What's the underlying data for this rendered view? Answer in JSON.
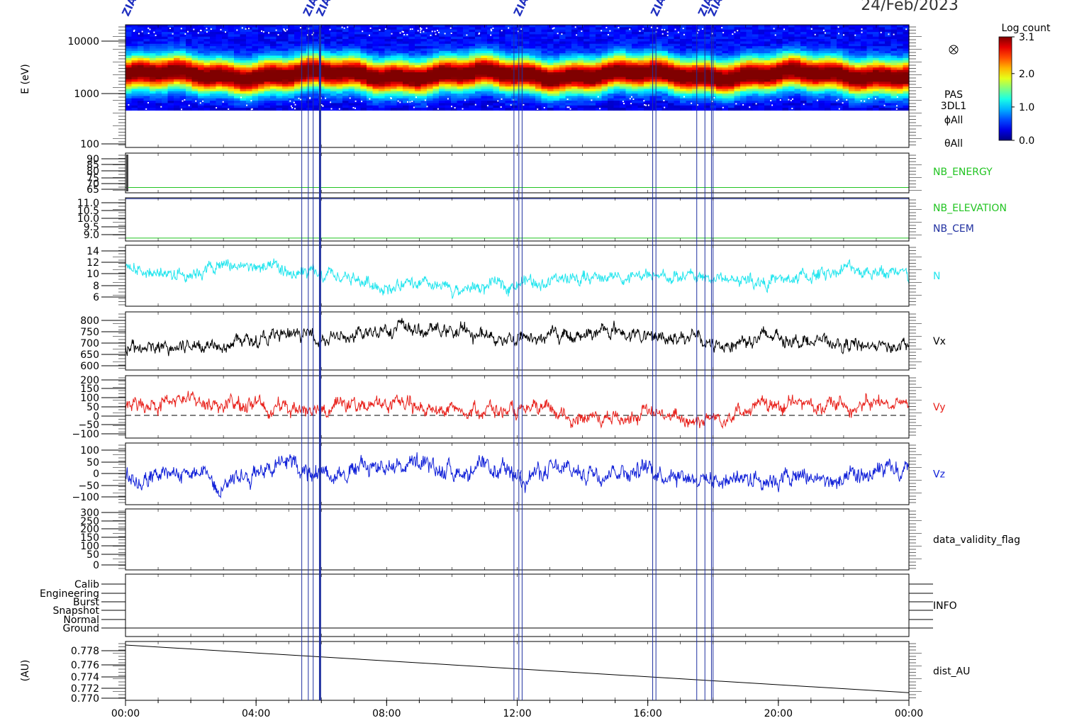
{
  "date_label": "24/Feb/2023",
  "x_tick_labels": [
    "00:00",
    "04:00",
    "08:00",
    "12:00",
    "16:00",
    "20:00",
    "00:00"
  ],
  "event_marker_label": "ZIAS",
  "event_markers_hours": [
    5.4,
    5.6,
    5.75,
    5.95,
    5.97,
    11.9,
    12.05,
    12.15,
    16.15,
    16.25,
    17.5,
    17.75,
    17.95,
    18.0
  ],
  "colorbar": {
    "title": "Log count",
    "ticks": [
      "3.1",
      "2.0",
      "1.0",
      "0.0"
    ],
    "min": 0.0,
    "max": 3.1
  },
  "spectrogram_labels": [
    "PAS",
    "3DL1",
    "ϕAll",
    "θAll"
  ],
  "colors": {
    "cyan": "#22e5ee",
    "black": "#000000",
    "red": "#e8201a",
    "blue": "#1020d8",
    "green": "#22c422",
    "navy": "#2030a0",
    "frame": "#000000"
  },
  "chart_data": [
    {
      "type": "heatmap",
      "name": "energy_spectrogram",
      "ylabel": "E (eV)",
      "yscale": "log",
      "ylim": [
        100,
        20000
      ],
      "y_tick_labels": [
        "10000",
        "1000",
        "100"
      ],
      "x_range_hours": [
        0,
        24
      ],
      "peak_energy_ev": 2300,
      "data_min_energy_ev": 500
    },
    {
      "type": "line",
      "name": "NB_ENERGY",
      "legend": "NB_ENERGY",
      "legend_color": "#22c422",
      "ylim": [
        62,
        92
      ],
      "y_tick_labels": [
        "90",
        "85",
        "80",
        "75",
        "70",
        "65"
      ],
      "constant_value": 66
    },
    {
      "type": "line",
      "series_labels": [
        "NB_ELEVATION",
        "NB_CEM"
      ],
      "legend_colors": [
        "#22c422",
        "#2030a0"
      ],
      "ylim": [
        8.85,
        11.05
      ],
      "y_tick_labels": [
        "11.0",
        "10.5",
        "10.0",
        "9.5",
        "9.0"
      ],
      "values": {
        "NB_CEM": 11.0,
        "NB_ELEVATION": 9.0
      }
    },
    {
      "type": "line",
      "legend": "N",
      "legend_color": "#22e5ee",
      "ylim": [
        4.3,
        14.4
      ],
      "y_tick_labels": [
        "14",
        "12",
        "10",
        "8",
        "6"
      ],
      "x_hours": [
        0,
        1,
        2,
        3,
        4,
        5,
        6,
        7,
        8,
        9,
        10,
        11,
        12,
        13,
        14,
        15,
        16,
        17,
        18,
        19,
        20,
        21,
        22,
        23,
        24
      ],
      "values": [
        10.8,
        9.8,
        10.0,
        11.0,
        10.8,
        9.7,
        9.2,
        8.8,
        7.6,
        7.6,
        6.9,
        7.4,
        8.3,
        8.6,
        8.9,
        9.3,
        9.0,
        9.2,
        8.9,
        8.6,
        8.4,
        9.3,
        10.6,
        10.2,
        8.8
      ]
    },
    {
      "type": "line",
      "legend": "Vx",
      "legend_color": "#000000",
      "ylim": [
        585,
        815
      ],
      "y_tick_labels": [
        "800",
        "750",
        "700",
        "650",
        "600"
      ],
      "x_hours": [
        0,
        1,
        2,
        3,
        4,
        5,
        6,
        7,
        8,
        9,
        10,
        11,
        12,
        13,
        14,
        15,
        16,
        17,
        18,
        19,
        20,
        21,
        22,
        23,
        24
      ],
      "values": [
        670,
        665,
        680,
        700,
        705,
        720,
        720,
        705,
        760,
        740,
        740,
        720,
        712,
        718,
        725,
        745,
        710,
        725,
        680,
        705,
        720,
        700,
        680,
        685,
        670
      ]
    },
    {
      "type": "line",
      "legend": "Vy",
      "legend_color": "#e8201a",
      "ylim": [
        -120,
        210
      ],
      "y_tick_labels": [
        "200",
        "150",
        "100",
        "50",
        "0",
        "−50",
        "−100"
      ],
      "dashed_reference": 0,
      "x_hours": [
        0,
        1,
        2,
        3,
        4,
        5,
        6,
        7,
        8,
        9,
        10,
        11,
        12,
        13,
        14,
        15,
        16,
        17,
        18,
        19,
        20,
        21,
        22,
        23,
        24
      ],
      "values": [
        45,
        70,
        80,
        55,
        60,
        30,
        50,
        55,
        60,
        35,
        30,
        40,
        10,
        20,
        -15,
        -10,
        10,
        -20,
        -15,
        35,
        50,
        60,
        55,
        65,
        60
      ]
    },
    {
      "type": "line",
      "legend": "Vz",
      "legend_color": "#1020d8",
      "ylim": [
        -120,
        120
      ],
      "y_tick_labels": [
        "100",
        "50",
        "0",
        "−50",
        "−100"
      ],
      "x_hours": [
        0,
        1,
        2,
        3,
        4,
        5,
        6,
        7,
        8,
        9,
        10,
        11,
        12,
        13,
        14,
        15,
        16,
        17,
        18,
        19,
        20,
        21,
        22,
        23,
        24
      ],
      "values": [
        -15,
        -20,
        5,
        -30,
        20,
        40,
        10,
        15,
        40,
        30,
        15,
        10,
        -5,
        10,
        5,
        20,
        15,
        5,
        -25,
        -10,
        -15,
        -15,
        -40,
        5,
        -5
      ]
    },
    {
      "type": "line",
      "legend": "data_validity_flag",
      "legend_color": "#000000",
      "ylim": [
        -20,
        300
      ],
      "y_tick_labels": [
        "300",
        "250",
        "200",
        "150",
        "100",
        "50",
        "0"
      ]
    },
    {
      "type": "line",
      "legend": "INFO",
      "legend_color": "#000000",
      "y_tick_labels": [
        "Calib",
        "Engineering",
        "Burst",
        "Snapshot",
        "Normal",
        "Ground"
      ]
    },
    {
      "type": "line",
      "legend": "dist_AU",
      "legend_color": "#000000",
      "ylabel": "(AU)",
      "ylim": [
        0.7695,
        0.7795
      ],
      "y_tick_labels": [
        "0.778",
        "0.776",
        "0.774",
        "0.772",
        "0.770"
      ],
      "x_hours": [
        0,
        24
      ],
      "values": [
        0.7789,
        0.7708
      ]
    }
  ]
}
